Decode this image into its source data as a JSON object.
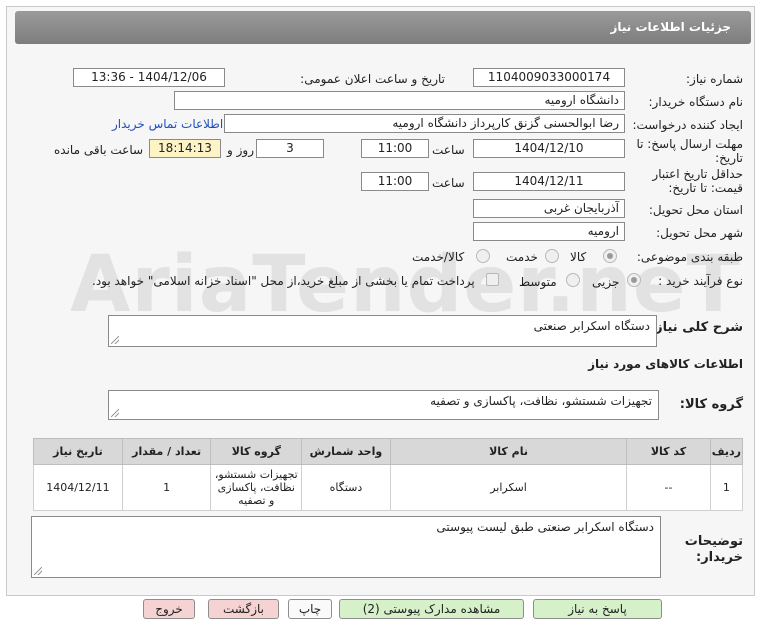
{
  "header": {
    "title": "جزئیات اطلاعات نیاز"
  },
  "fields": {
    "need_number_label": "شماره نیاز:",
    "need_number": "1104009033000174",
    "announce_label": "تاریخ و ساعت اعلان عمومی:",
    "announce_value": "1404/12/06 - 13:36",
    "buyer_org_label": "نام دستگاه خریدار:",
    "buyer_org": "دانشگاه ارومیه",
    "creator_label": "ایجاد کننده درخواست:",
    "creator": "رضا ابوالحسنی گزنق کارپرداز دانشگاه ارومیه",
    "contact_link": "اطلاعات تماس خریدار",
    "deadline_label_1": "مهلت ارسال پاسخ: تا",
    "deadline_label_2": "تاریخ:",
    "deadline_date": "1404/12/10",
    "time_label": "ساعت",
    "deadline_time": "11:00",
    "days_value": "3",
    "days_label": "روز و",
    "remaining_value": "18:14:13",
    "remaining_label": "ساعت باقی مانده",
    "validity_label_1": "حداقل تاریخ اعتبار",
    "validity_label_2": "قیمت: تا تاریخ:",
    "validity_date": "1404/12/11",
    "validity_time_label": "ساعت",
    "validity_time": "11:00",
    "province_label": "استان محل تحویل:",
    "province": "آذربایجان غربی",
    "city_label": "شهر محل تحویل:",
    "city": "ارومیه",
    "category_label": "طبقه بندی موضوعی:",
    "category_options": [
      "کالا",
      "خدمت",
      "کالا/خدمت"
    ],
    "process_label": "نوع فرآیند خرید :",
    "process_options": [
      "جزیی",
      "متوسط"
    ],
    "treasury_text": "پرداخت تمام یا بخشی از مبلغ خرید،از محل \"اسناد خزانه اسلامی\" خواهد بود."
  },
  "summary": {
    "label": "شرح کلی نیاز:",
    "value": "دستگاه اسکرابر صنعتی"
  },
  "goods_section": {
    "title": "اطلاعات کالاهای مورد نیاز"
  },
  "goods_group": {
    "label": "گروه کالا:",
    "value": "تجهیزات شستشو، نظافت، پاکسازی و تصفیه"
  },
  "table": {
    "headers": [
      "ردیف",
      "کد کالا",
      "نام کالا",
      "واحد شمارش",
      "گروه کالا",
      "تعداد / مقدار",
      "تاریخ نیاز"
    ],
    "rows": [
      [
        "1",
        "--",
        "اسکرابر",
        "دستگاه",
        "تجهیزات شستشو، نظافت، پاکسازی و تصفیه",
        "1",
        "1404/12/11"
      ]
    ]
  },
  "buyer_notes": {
    "label_1": "توضیحات",
    "label_2": "خریدار:",
    "value": "دستگاه اسکرابر صنعتی طبق لیست پیوستی"
  },
  "buttons": {
    "reply": "پاسخ به نیاز",
    "attachments": "مشاهده مدارک پیوستی (2)",
    "print": "چاپ",
    "back": "بازگشت",
    "exit": "خروج"
  },
  "watermark": "AriaTender.neT"
}
